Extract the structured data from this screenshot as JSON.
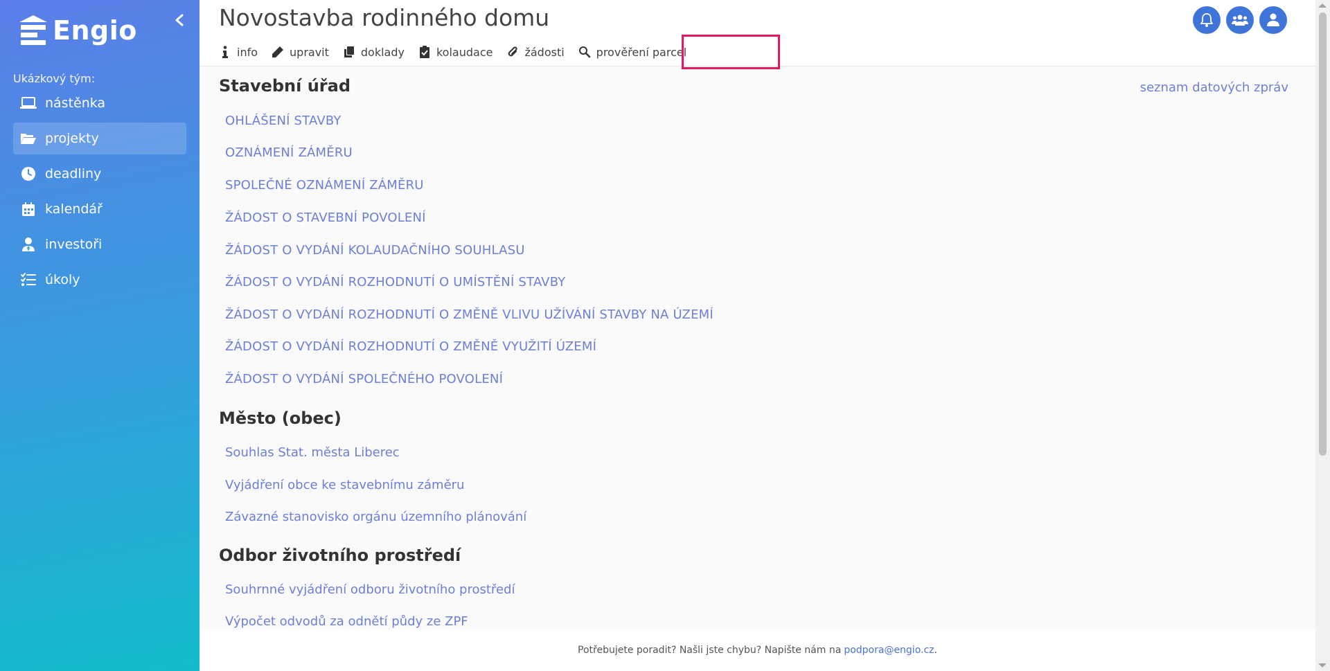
{
  "sidebar": {
    "logo_text": "Engio",
    "team_label": "Ukázkový tým:",
    "items": [
      {
        "label": "nástěnka",
        "icon": "laptop-icon"
      },
      {
        "label": "projekty",
        "icon": "folder-open-icon",
        "active": true
      },
      {
        "label": "deadliny",
        "icon": "clock-icon"
      },
      {
        "label": "kalendář",
        "icon": "calendar-icon"
      },
      {
        "label": "investoři",
        "icon": "user-tie-icon"
      },
      {
        "label": "úkoly",
        "icon": "tasks-icon"
      }
    ]
  },
  "header": {
    "title": "Novostavba rodinného domu",
    "tabs": [
      {
        "label": "info",
        "icon": "info-icon"
      },
      {
        "label": "upravit",
        "icon": "pencil-icon"
      },
      {
        "label": "doklady",
        "icon": "copy-icon"
      },
      {
        "label": "kolaudace",
        "icon": "clipboard-check-icon"
      },
      {
        "label": "žádosti",
        "icon": "paperclip-icon"
      },
      {
        "label": "prověření parcel",
        "icon": "search-icon"
      }
    ],
    "icons": [
      "bell-icon",
      "users-icon",
      "user-icon"
    ]
  },
  "content": {
    "top_right_link": "seznam datových zpráv",
    "sections": [
      {
        "title": "Stavební úřad",
        "links": [
          "OHLÁŠENÍ STAVBY",
          "OZNÁMENÍ ZÁMĚRU",
          "SPOLEČNÉ OZNÁMENÍ ZÁMĚRU",
          "ŽÁDOST O STAVEBNÍ POVOLENÍ",
          "ŽÁDOST O VYDÁNÍ KOLAUDAČNÍHO SOUHLASU",
          "ŽÁDOST O VYDÁNÍ ROZHODNUTÍ O UMÍSTĚNÍ STAVBY",
          "ŽÁDOST O VYDÁNÍ ROZHODNUTÍ O ZMĚNĚ VLIVU UŽÍVÁNÍ STAVBY NA ÚZEMÍ",
          "ŽÁDOST O VYDÁNÍ ROZHODNUTÍ O ZMĚNĚ VYUŽITÍ ÚZEMÍ",
          "ŽÁDOST O VYDÁNÍ SPOLEČNÉHO POVOLENÍ"
        ]
      },
      {
        "title": "Město (obec)",
        "links": [
          "Souhlas Stat. města Liberec",
          "Vyjádření obce ke stavebnímu záměru",
          "Závazné stanovisko orgánu územního plánování"
        ]
      },
      {
        "title": "Odbor životního prostředí",
        "links": [
          "Souhrnné vyjádření odboru životního prostředí",
          "Výpočet odvodů za odnětí půdy ze ZPF"
        ]
      }
    ]
  },
  "footer": {
    "text": "Potřebujete poradit? Našli jste chybu? Napište nám na",
    "email": "podpora@engio.cz",
    "suffix": "."
  },
  "colors": {
    "accent": "#3f75d9",
    "link": "#6c7fd8",
    "highlight": "#e5175f"
  }
}
